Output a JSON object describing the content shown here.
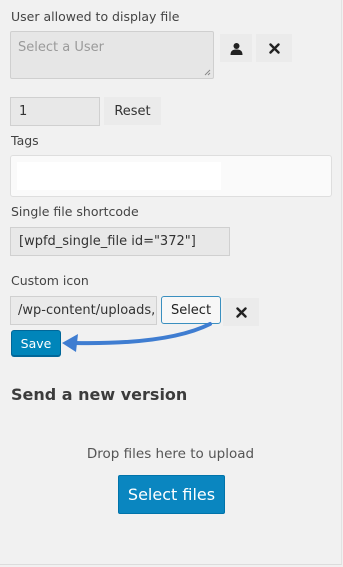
{
  "user_field": {
    "label": "User allowed to display file",
    "placeholder": "Select a User"
  },
  "icons": {
    "user": "user-icon",
    "clear": "close-icon"
  },
  "version": {
    "value": "1",
    "reset_label": "Reset"
  },
  "tags": {
    "label": "Tags"
  },
  "shortcode": {
    "label": "Single file shortcode",
    "value": "[wpfd_single_file id=\"372\"]"
  },
  "custom_icon": {
    "label": "Custom icon",
    "value": "/wp-content/uploads,",
    "select_label": "Select"
  },
  "save_label": "Save",
  "new_version": {
    "heading": "Send a new version",
    "drop_text": "Drop files here to upload",
    "select_files_label": "Select files"
  },
  "colors": {
    "primary": "#0085ba",
    "arrow": "#3f7dd1"
  }
}
